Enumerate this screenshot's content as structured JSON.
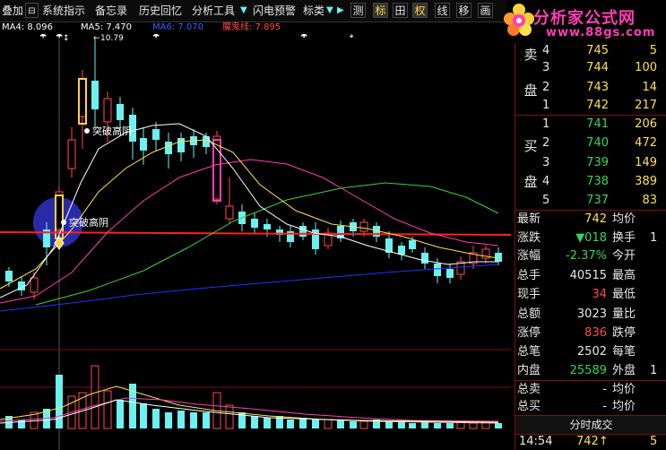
{
  "toolbar": {
    "items": [
      "叠加",
      "系统指示",
      "备忘录",
      "历史回忆",
      "分析工具",
      "闪电预警",
      "标类"
    ],
    "square_buttons": [
      "测",
      "标",
      "田",
      "权",
      "线",
      "移",
      "画"
    ]
  },
  "logo": {
    "title": "分析家公式网",
    "url": "www.88gs.com"
  },
  "ma_labels": {
    "ma4": "MA4: 8.096",
    "ma5": "MA5: 7.470",
    "ma6": "MA6: 7.070",
    "demon": "魔鬼线: 7.895",
    "peak": "10.79"
  },
  "annotations": {
    "signal_1": "突破高阴",
    "signal_2": "突破高阴"
  },
  "order_book": {
    "sell_label_1": "卖",
    "sell_label_2": "盘",
    "buy_label_1": "买",
    "buy_label_2": "盘",
    "sell": [
      {
        "level": "4",
        "price": "745",
        "vol": "5"
      },
      {
        "level": "3",
        "price": "744",
        "vol": "100"
      },
      {
        "level": "2",
        "price": "743",
        "vol": "14"
      },
      {
        "level": "1",
        "price": "742",
        "vol": "217"
      }
    ],
    "buy": [
      {
        "level": "1",
        "price": "741",
        "vol": "206"
      },
      {
        "level": "2",
        "price": "740",
        "vol": "472"
      },
      {
        "level": "3",
        "price": "739",
        "vol": "149"
      },
      {
        "level": "4",
        "price": "738",
        "vol": "389"
      },
      {
        "level": "5",
        "price": "737",
        "vol": "83"
      }
    ]
  },
  "stats": [
    {
      "k": "最新",
      "v": "742",
      "k2": "均价",
      "v2": ""
    },
    {
      "k": "涨跌",
      "v": "▼018",
      "k2": "换手",
      "v2": "1"
    },
    {
      "k": "涨幅",
      "v": "-2.37%",
      "k2": "今开",
      "v2": ""
    },
    {
      "k": "总手",
      "v": "40515",
      "k2": "最高",
      "v2": ""
    },
    {
      "k": "现手",
      "v": "34",
      "k2": "最低",
      "v2": ""
    },
    {
      "k": "总额",
      "v": "3023",
      "k2": "量比",
      "v2": ""
    },
    {
      "k": "涨停",
      "v": "836",
      "k2": "跌停",
      "v2": ""
    },
    {
      "k": "总笔",
      "v": "2502",
      "k2": "每笔",
      "v2": ""
    },
    {
      "k": "内盘",
      "v": "25589",
      "k2": "外盘",
      "v2": "1"
    },
    {
      "k": "总卖",
      "v": "-",
      "k2": "均价",
      "v2": ""
    },
    {
      "k": "总买",
      "v": "-",
      "k2": "均价",
      "v2": ""
    }
  ],
  "time_sales": {
    "header": "分时成交",
    "time": "14:54",
    "price": "742↑",
    "vol": "5"
  },
  "colors": {
    "up": "#ff4a4a",
    "down": "#6cf0f0",
    "ma4": "#ffffff",
    "ma5": "#ffe14d",
    "ma6": "#ff3fb4",
    "demon": "#ff2020"
  }
}
